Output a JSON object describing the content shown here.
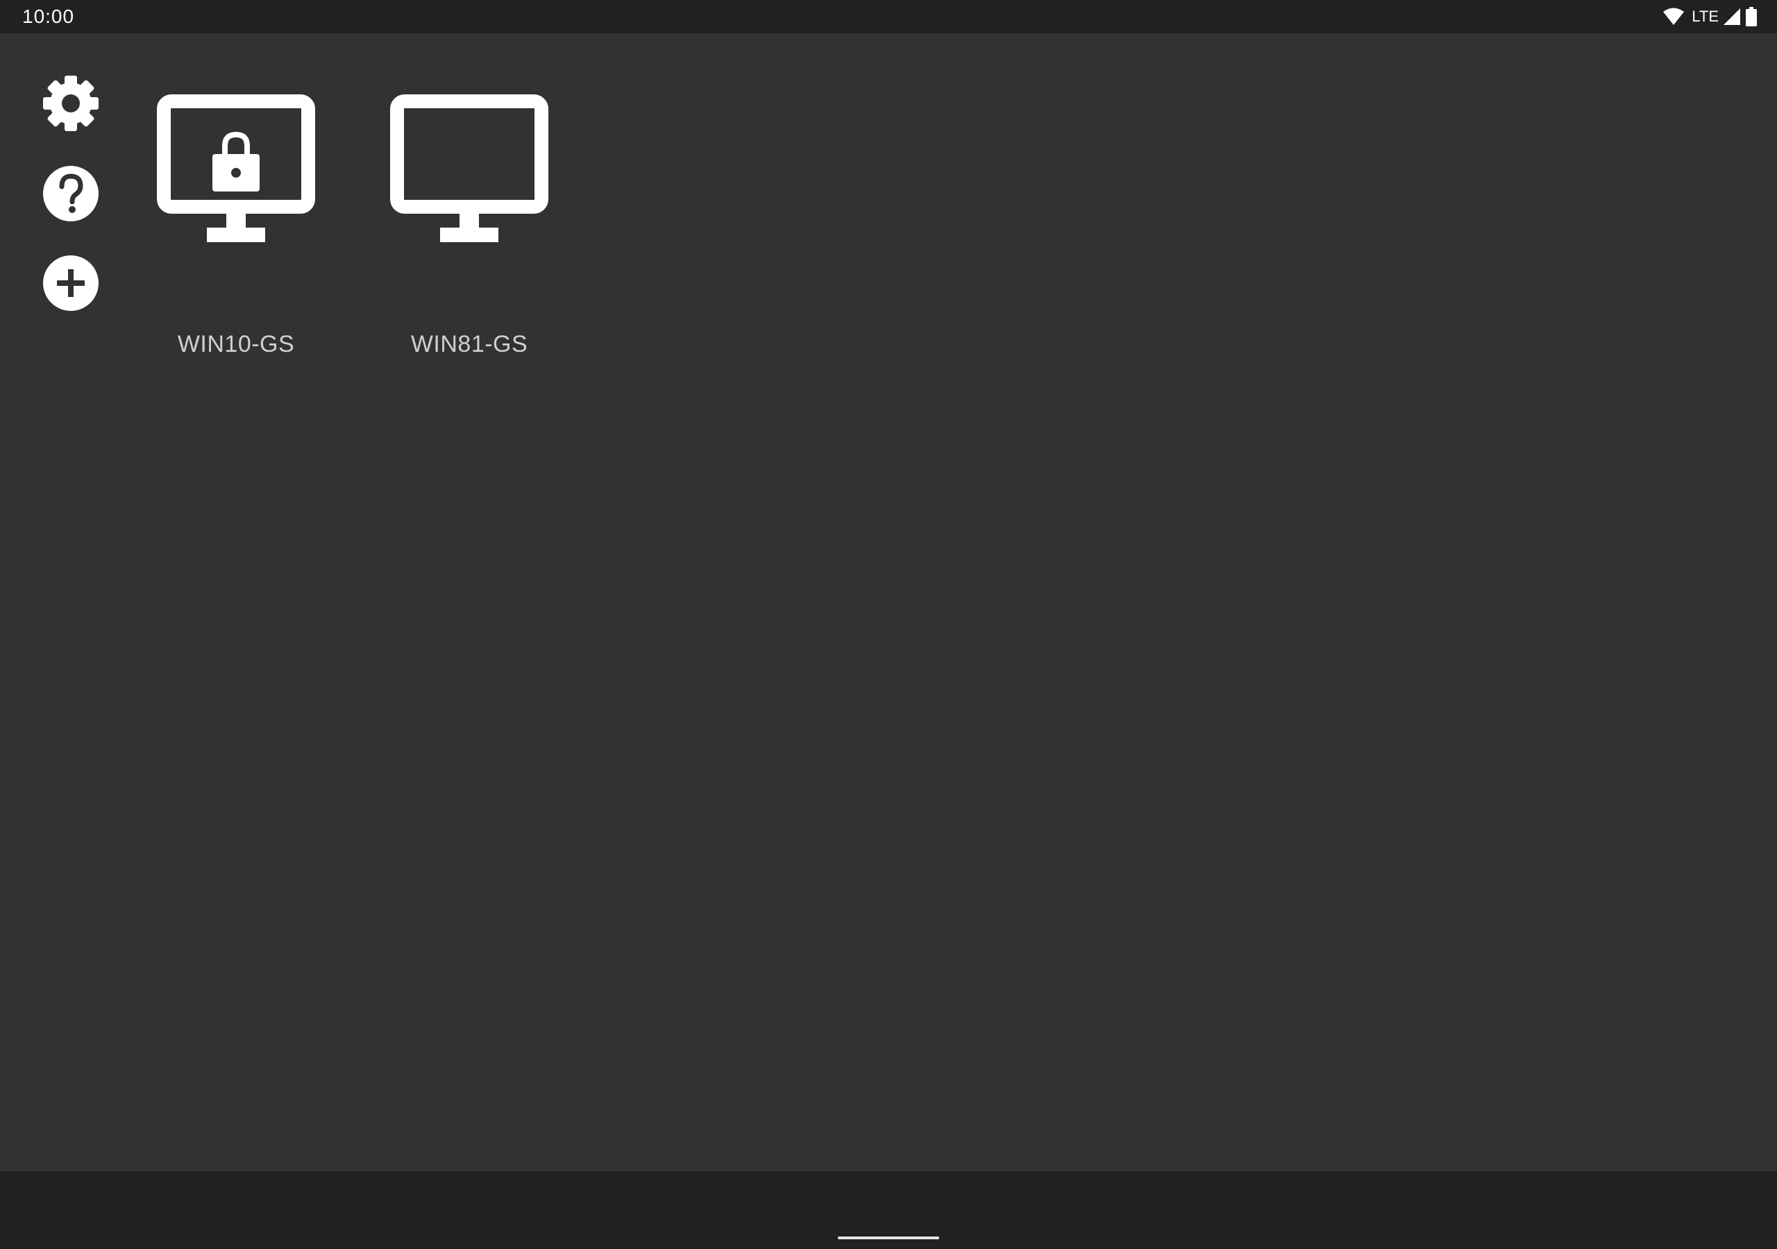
{
  "status_bar": {
    "time": "10:00",
    "network_label": "LTE",
    "icons": [
      "wifi-icon",
      "cell-signal-icon",
      "battery-icon"
    ]
  },
  "sidebar": {
    "items": [
      {
        "name": "settings",
        "icon": "gear-icon"
      },
      {
        "name": "help",
        "icon": "help-circle-icon"
      },
      {
        "name": "add-host",
        "icon": "add-circle-icon"
      }
    ]
  },
  "hosts": [
    {
      "label": "WIN10-GS",
      "icon": "monitor-locked-icon",
      "locked": true
    },
    {
      "label": "WIN81-GS",
      "icon": "monitor-icon",
      "locked": false
    }
  ],
  "colors": {
    "background": "#323232",
    "bars": "#212121",
    "icon": "#ffffff",
    "label": "#d0d0d0"
  }
}
